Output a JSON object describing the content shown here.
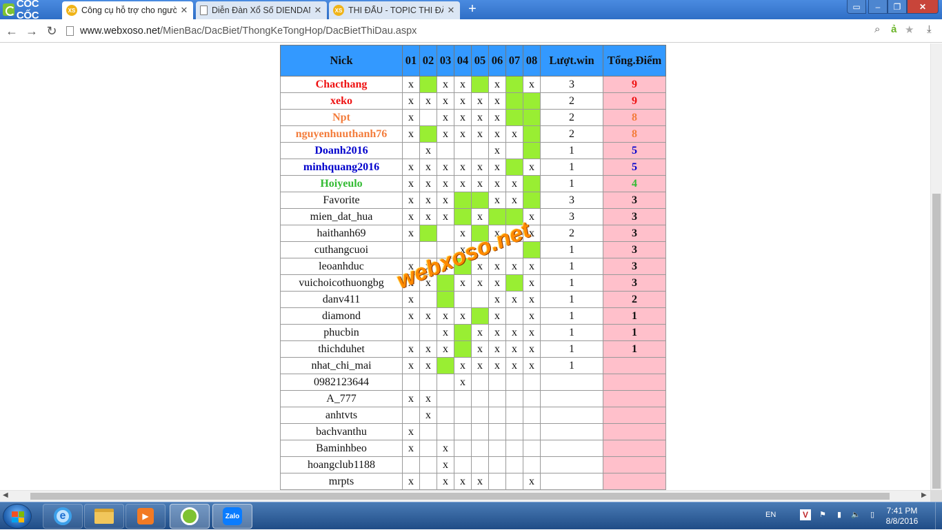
{
  "browser": {
    "brand": "CỐC CỐC",
    "tabs": [
      {
        "title": "Công cụ hỗ trợ cho người",
        "active": true,
        "icon": "xs-icon"
      },
      {
        "title": "Diễn Đàn Xổ Số DIENDAN",
        "active": false,
        "icon": "page-icon"
      },
      {
        "title": "THI ĐẤU - TOPIC THI ĐẤU",
        "active": false,
        "icon": "xs-icon"
      }
    ],
    "url_host": "www.webxoso.net",
    "url_path": "/MienBac/DacBiet/ThongKeTongHop/DacBietThiDau.aspx"
  },
  "table": {
    "headers": [
      "Nick",
      "01",
      "02",
      "03",
      "04",
      "05",
      "06",
      "07",
      "08",
      "Lượt.win",
      "Tổng.Điểm"
    ],
    "rows": [
      {
        "nick": "Chacthang",
        "color": "red",
        "cells": [
          "x",
          "g",
          "x",
          "x",
          "g",
          "x",
          "g",
          "x"
        ],
        "wins": "3",
        "points": "9"
      },
      {
        "nick": "xeko",
        "color": "red",
        "cells": [
          "x",
          "x",
          "x",
          "x",
          "x",
          "x",
          "g",
          "g"
        ],
        "wins": "2",
        "points": "9"
      },
      {
        "nick": "Npt",
        "color": "orange",
        "cells": [
          "x",
          "",
          "x",
          "x",
          "x",
          "x",
          "g",
          "g"
        ],
        "wins": "2",
        "points": "8"
      },
      {
        "nick": "nguyenhuuthanh76",
        "color": "orange",
        "cells": [
          "x",
          "g",
          "x",
          "x",
          "x",
          "x",
          "x",
          "g"
        ],
        "wins": "2",
        "points": "8"
      },
      {
        "nick": "Doanh2016",
        "color": "blue",
        "cells": [
          "",
          "x",
          "",
          "",
          "",
          "x",
          "",
          "g"
        ],
        "wins": "1",
        "points": "5"
      },
      {
        "nick": "minhquang2016",
        "color": "blue",
        "cells": [
          "x",
          "x",
          "x",
          "x",
          "x",
          "x",
          "g",
          "x"
        ],
        "wins": "1",
        "points": "5"
      },
      {
        "nick": "Hoiyeulo",
        "color": "green",
        "cells": [
          "x",
          "x",
          "x",
          "x",
          "x",
          "x",
          "x",
          "g"
        ],
        "wins": "1",
        "points": "4"
      },
      {
        "nick": "Favorite",
        "color": "plain",
        "cells": [
          "x",
          "x",
          "x",
          "g",
          "g",
          "x",
          "x",
          "g"
        ],
        "wins": "3",
        "points": "3"
      },
      {
        "nick": "mien_dat_hua",
        "color": "plain",
        "cells": [
          "x",
          "x",
          "x",
          "g",
          "x",
          "g",
          "g",
          "x"
        ],
        "wins": "3",
        "points": "3"
      },
      {
        "nick": "haithanh69",
        "color": "plain",
        "cells": [
          "x",
          "g",
          "",
          "x",
          "g",
          "x",
          "",
          "x"
        ],
        "wins": "2",
        "points": "3"
      },
      {
        "nick": "cuthangcuoi",
        "color": "plain",
        "cells": [
          "",
          "",
          "",
          "x",
          "",
          "",
          "",
          "g"
        ],
        "wins": "1",
        "points": "3"
      },
      {
        "nick": "leoanhduc",
        "color": "plain",
        "cells": [
          "x",
          "x",
          "x",
          "g",
          "x",
          "x",
          "x",
          "x"
        ],
        "wins": "1",
        "points": "3"
      },
      {
        "nick": "vuichoicothuongbg",
        "color": "plain",
        "cells": [
          "x",
          "x",
          "g",
          "x",
          "x",
          "x",
          "g",
          "x"
        ],
        "wins": "1",
        "points": "3"
      },
      {
        "nick": "danv411",
        "color": "plain",
        "cells": [
          "x",
          "",
          "g",
          "",
          "",
          "x",
          "x",
          "x"
        ],
        "wins": "1",
        "points": "2"
      },
      {
        "nick": "diamond",
        "color": "plain",
        "cells": [
          "x",
          "x",
          "x",
          "x",
          "g",
          "x",
          "",
          "x"
        ],
        "wins": "1",
        "points": "1"
      },
      {
        "nick": "phucbin",
        "color": "plain",
        "cells": [
          "",
          "",
          "x",
          "g",
          "x",
          "x",
          "x",
          "x"
        ],
        "wins": "1",
        "points": "1"
      },
      {
        "nick": "thichduhet",
        "color": "plain",
        "cells": [
          "x",
          "x",
          "x",
          "g",
          "x",
          "x",
          "x",
          "x"
        ],
        "wins": "1",
        "points": "1"
      },
      {
        "nick": "nhat_chi_mai",
        "color": "plain",
        "cells": [
          "x",
          "x",
          "g",
          "x",
          "x",
          "x",
          "x",
          "x"
        ],
        "wins": "1",
        "points": ""
      },
      {
        "nick": "0982123644",
        "color": "plain",
        "cells": [
          "",
          "",
          "",
          "x",
          "",
          "",
          "",
          ""
        ],
        "wins": "",
        "points": ""
      },
      {
        "nick": "A_777",
        "color": "plain",
        "cells": [
          "x",
          "x",
          "",
          "",
          "",
          "",
          "",
          ""
        ],
        "wins": "",
        "points": ""
      },
      {
        "nick": "anhtvts",
        "color": "plain",
        "cells": [
          "",
          "x",
          "",
          "",
          "",
          "",
          "",
          ""
        ],
        "wins": "",
        "points": ""
      },
      {
        "nick": "bachvanthu",
        "color": "plain",
        "cells": [
          "x",
          "",
          "",
          "",
          "",
          "",
          "",
          ""
        ],
        "wins": "",
        "points": ""
      },
      {
        "nick": "Baminhbeo",
        "color": "plain",
        "cells": [
          "x",
          "",
          "x",
          "",
          "",
          "",
          "",
          ""
        ],
        "wins": "",
        "points": ""
      },
      {
        "nick": "hoangclub1188",
        "color": "plain",
        "cells": [
          "",
          "",
          "x",
          "",
          "",
          "",
          "",
          ""
        ],
        "wins": "",
        "points": ""
      },
      {
        "nick": "mrpts",
        "color": "plain",
        "cells": [
          "x",
          "",
          "x",
          "x",
          "x",
          "",
          "",
          "x"
        ],
        "wins": "",
        "points": ""
      }
    ]
  },
  "watermark": "webxoso.net",
  "taskbar": {
    "apps": [
      "internet-explorer-icon",
      "folder-icon",
      "media-player-icon",
      "coccoc-icon",
      "zalo-icon"
    ],
    "zalo_label": "Zalo",
    "lang": "EN",
    "time": "7:41 PM",
    "date": "8/8/2016"
  },
  "colors": {
    "header": "#3399ff",
    "win_cell": "#99ee33",
    "points_bg": "#ffc0cb"
  }
}
